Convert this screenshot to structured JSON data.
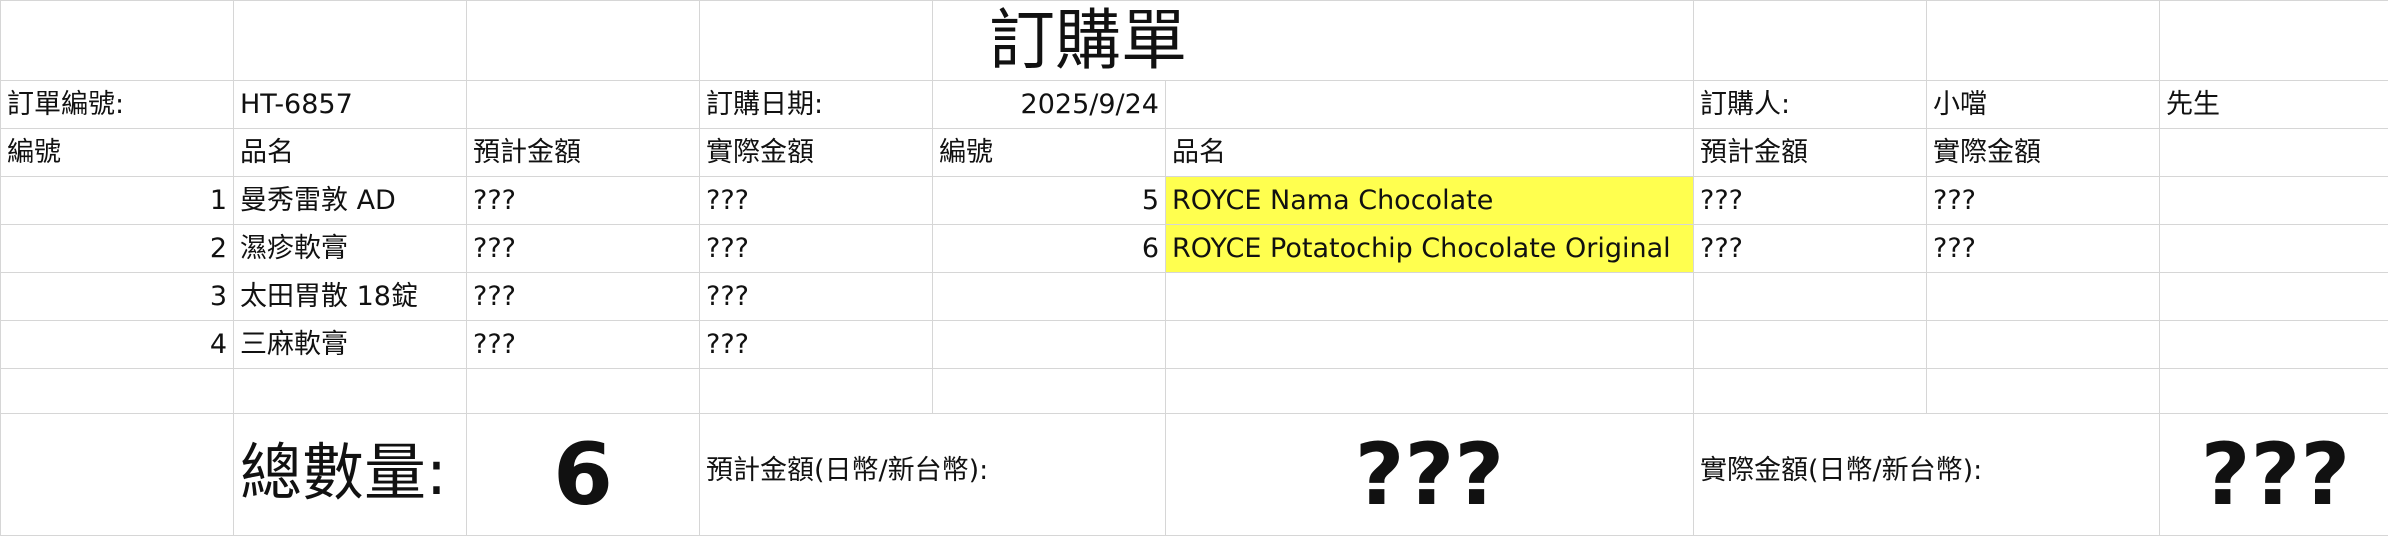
{
  "title": "訂購單",
  "header": {
    "order_no_label": "訂單編號:",
    "order_no": "HT-6857",
    "date_label": "訂購日期:",
    "date": "2025/9/24",
    "buyer_label": "訂購人:",
    "buyer_name": "小噹",
    "buyer_title": "先生"
  },
  "columns": {
    "no": "編號",
    "name": "品名",
    "est": "預計金額",
    "act": "實際金額"
  },
  "left_items": [
    {
      "no": "1",
      "name": "曼秀雷敦 AD",
      "est": "???",
      "act": "???"
    },
    {
      "no": "2",
      "name": "濕疹軟膏",
      "est": "???",
      "act": "???"
    },
    {
      "no": "3",
      "name": "太田胃散 18錠",
      "est": "???",
      "act": "???"
    },
    {
      "no": "4",
      "name": "三麻軟膏",
      "est": "???",
      "act": "???"
    }
  ],
  "right_items": [
    {
      "no": "5",
      "name": "ROYCE Nama Chocolate",
      "est": "???",
      "act": "???"
    },
    {
      "no": "6",
      "name": "ROYCE Potatochip Chocolate Original",
      "est": "???",
      "act": "???"
    }
  ],
  "summary": {
    "qty_label": "總數量:",
    "qty": "6",
    "est_label": "預計金額(日幣/新台幣):",
    "est": "???",
    "act_label": "實際金額(日幣/新台幣):",
    "act": "???"
  },
  "colors": {
    "highlight": "#ffff4f",
    "gridline": "#d6d6d6"
  }
}
